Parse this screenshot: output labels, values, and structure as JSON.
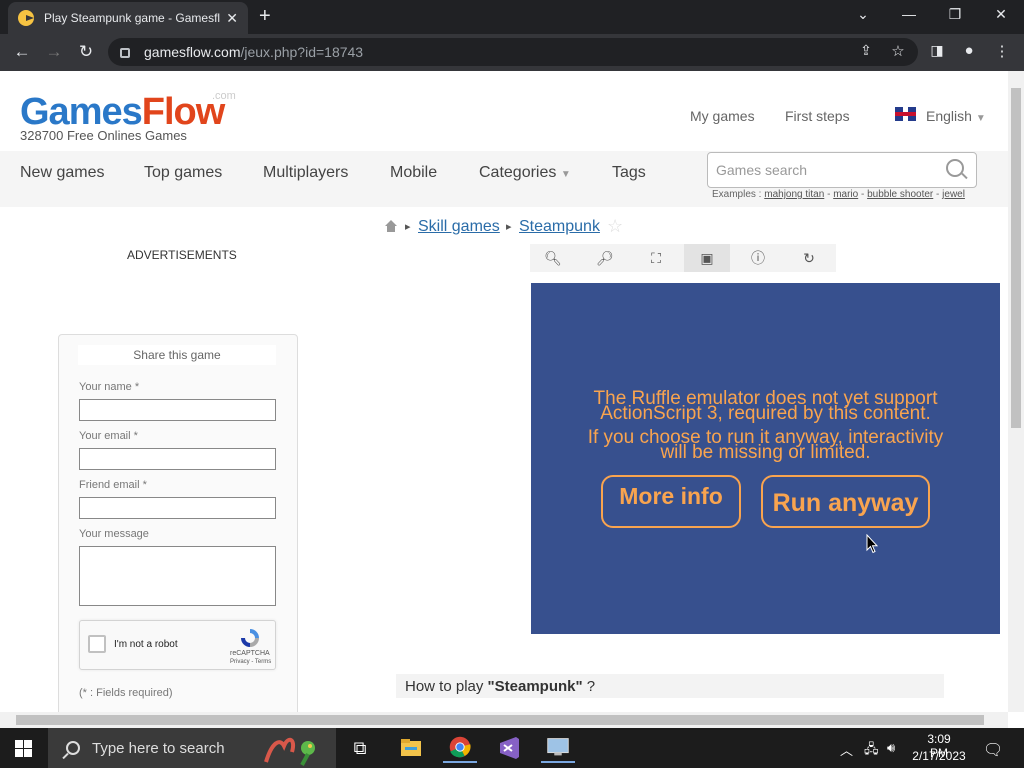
{
  "browser": {
    "tab_title": "Play Steampunk game - Gamesflow",
    "tab_close": "✕",
    "new_tab": "+",
    "url_host": "gamesflow.com",
    "url_path": "/jeux.php?id=18743"
  },
  "site": {
    "logo_games": "Games",
    "logo_flow": "Flow",
    "logo_com": ".com",
    "tagline": "328700 Free Onlines Games",
    "top_links": [
      "My games",
      "First steps"
    ],
    "language": "English",
    "nav": [
      "New games",
      "Top games",
      "Multiplayers",
      "Mobile",
      "Categories",
      "Tags"
    ],
    "search_placeholder": "Games search",
    "examples_label": "Examples :",
    "examples": [
      "mahjong titan",
      "mario",
      "bubble shooter",
      "jewel"
    ]
  },
  "breadcrumb": [
    "Skill games",
    "Steampunk"
  ],
  "ads_label": "ADVERTISEMENTS",
  "game": {
    "ruffle_line1": "The Ruffle emulator does not yet support",
    "ruffle_line2": "ActionScript 3, required by this content.",
    "ruffle_line3": "If you choose to run it anyway, interactivity",
    "ruffle_line4": "will be missing or limited.",
    "more_info": "More info",
    "run_anyway": "Run anyway",
    "bg_color": "#37508e",
    "accent_color": "#f9a44f"
  },
  "share": {
    "title": "Share this game",
    "name_label": "Your name *",
    "email_label": "Your email *",
    "friend_label": "Friend email *",
    "message_label": "Your message",
    "captcha_label": "I'm not a robot",
    "captcha_brand": "reCAPTCHA",
    "captcha_terms": "Privacy - Terms",
    "required_note": "(* : Fields required)"
  },
  "howto_prefix": "How to play ",
  "howto_game": "\"Steampunk\"",
  "howto_suffix": " ?",
  "taskbar": {
    "search_placeholder": "Type here to search",
    "time": "3:09 PM",
    "date": "2/17/2023"
  }
}
